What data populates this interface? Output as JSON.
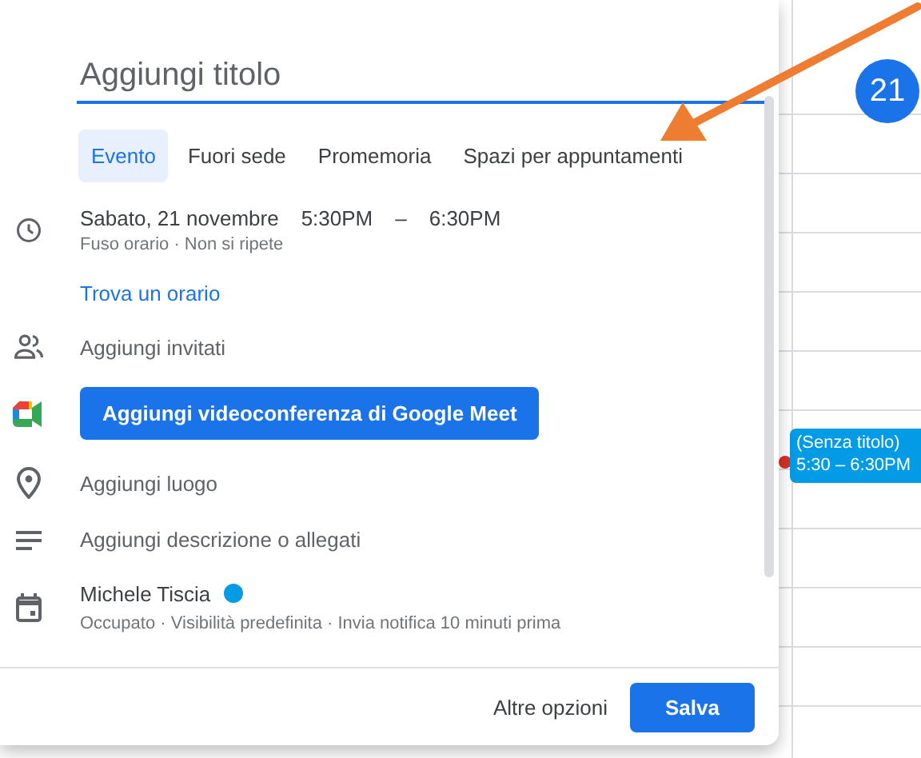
{
  "title_field": {
    "placeholder": "Aggiungi titolo"
  },
  "tabs": [
    {
      "label": "Evento",
      "selected": true
    },
    {
      "label": "Fuori sede",
      "selected": false
    },
    {
      "label": "Promemoria",
      "selected": false
    },
    {
      "label": "Spazi per appuntamenti",
      "selected": false
    }
  ],
  "rows": [
    {
      "kind": "datetime",
      "date": "Sabato, 21 novembre",
      "start": "5:30PM",
      "dash": "–",
      "end": "6:30PM",
      "details": "Fuso orario · Non si ripete"
    },
    {
      "kind": "link",
      "text": "Trova un orario"
    },
    {
      "kind": "guests",
      "text": "Aggiungi invitati"
    },
    {
      "kind": "meet",
      "text": "Aggiungi videoconferenza di Google Meet"
    },
    {
      "kind": "location",
      "text": "Aggiungi luogo"
    },
    {
      "kind": "description",
      "text": "Aggiungi descrizione o allegati"
    },
    {
      "kind": "calendar",
      "name": "Michele Tiscia",
      "color": "#039be5",
      "details": "Occupato · Visibilità predefinita · Invia notifica 10 minuti prima"
    }
  ],
  "footer": {
    "secondary": "Altre opzioni",
    "primary": "Salva"
  },
  "calendar": {
    "day": "21",
    "event": {
      "title": "(Senza titolo)",
      "time": "5:30 – 6:30PM"
    }
  }
}
